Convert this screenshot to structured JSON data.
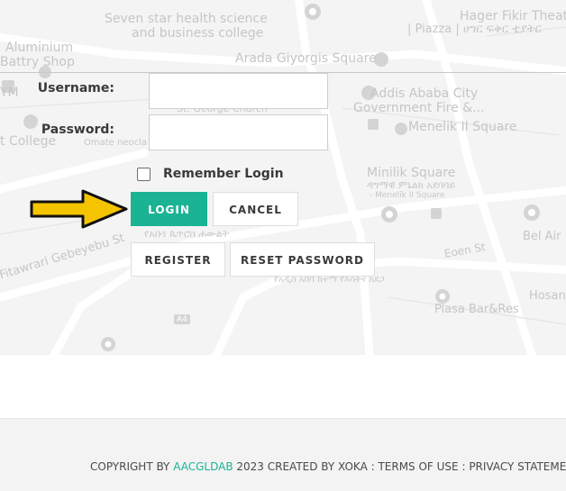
{
  "map": {
    "labels": [
      "Seven star health science",
      "and business college",
      "Aluminium",
      "Battry Shop",
      "Arada Giyorgis Square",
      "Hager Fikir Theatr",
      "| Piazza | ሀግር ፍቅር ቲያትር",
      "Addis Ababa City",
      "Government Fire &...",
      "Menelik II Square",
      "YM",
      "St. George Church",
      "t College",
      "Omate neocla",
      "Minilik Square",
      "ዳግማዊ ምኒልክ አደባባይ",
      "- Menelik II Square",
      "Bel Air",
      "Fitawrari Gebeyebu St",
      "የአቡነ ጴጥሮስ ሐውልት",
      "Eoen St",
      "የአዲስ አበባ ከተማ የእሳትና አደጋ",
      "Hosan",
      "Piasa Bar&Res",
      "A4"
    ]
  },
  "form": {
    "username_label": "Username:",
    "password_label": "Password:",
    "username_value": "",
    "password_value": "",
    "remember_label": "Remember Login",
    "remember_checked": false,
    "login_button": "LOGIN",
    "cancel_button": "CANCEL",
    "register_button": "REGISTER",
    "reset_button": "RESET PASSWORD"
  },
  "footer": {
    "prefix": "COPYRIGHT BY ",
    "brand": "AACGLDAB",
    "middle": " 2023 CREATED BY XOKA : ",
    "terms": "TERMS OF USE",
    "separator": " : ",
    "privacy": "PRIVACY STATEMENT"
  },
  "colors": {
    "accent": "#1ab394",
    "arrow_fill": "#f5c400",
    "arrow_stroke": "#111111",
    "footer_bg": "#f3f3f3",
    "map_bg": "#f4f4f4"
  },
  "icons": [
    "map-pin-icon",
    "arrow-right-icon",
    "checkbox-icon"
  ]
}
